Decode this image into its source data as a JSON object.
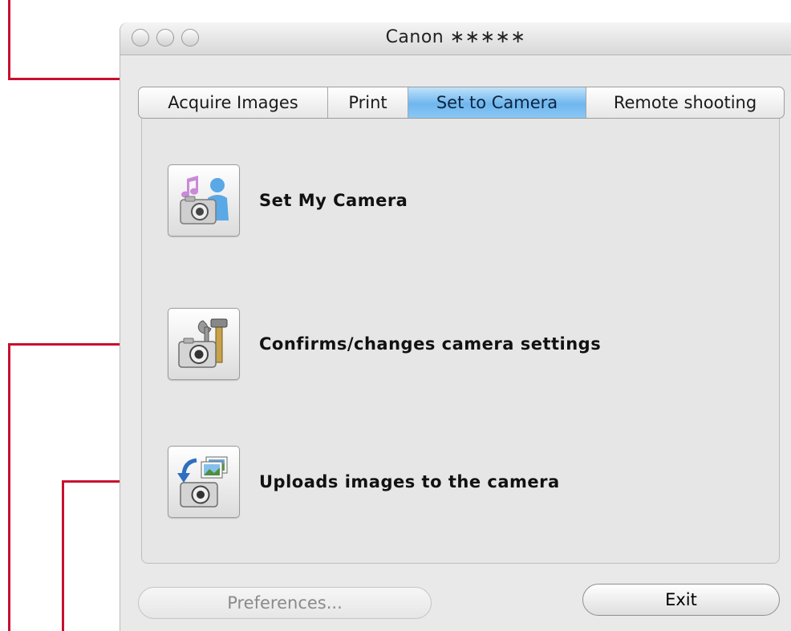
{
  "window": {
    "title": "Canon ∗∗∗∗∗"
  },
  "tabs": [
    {
      "label": "Acquire Images",
      "active": false
    },
    {
      "label": "Print",
      "active": false
    },
    {
      "label": "Set to Camera",
      "active": true
    },
    {
      "label": "Remote shooting",
      "active": false
    }
  ],
  "actions": [
    {
      "label": "Set My Camera",
      "icon": "camera-music-person-icon"
    },
    {
      "label": "Confirms/changes camera settings",
      "icon": "camera-tools-icon"
    },
    {
      "label": "Uploads images to the camera",
      "icon": "camera-upload-images-icon"
    }
  ],
  "footer": {
    "preferences_label": "Preferences...",
    "preferences_enabled": false,
    "exit_label": "Exit"
  },
  "colors": {
    "callout": "#c8102e",
    "active_tab": "#6fb6ee"
  }
}
